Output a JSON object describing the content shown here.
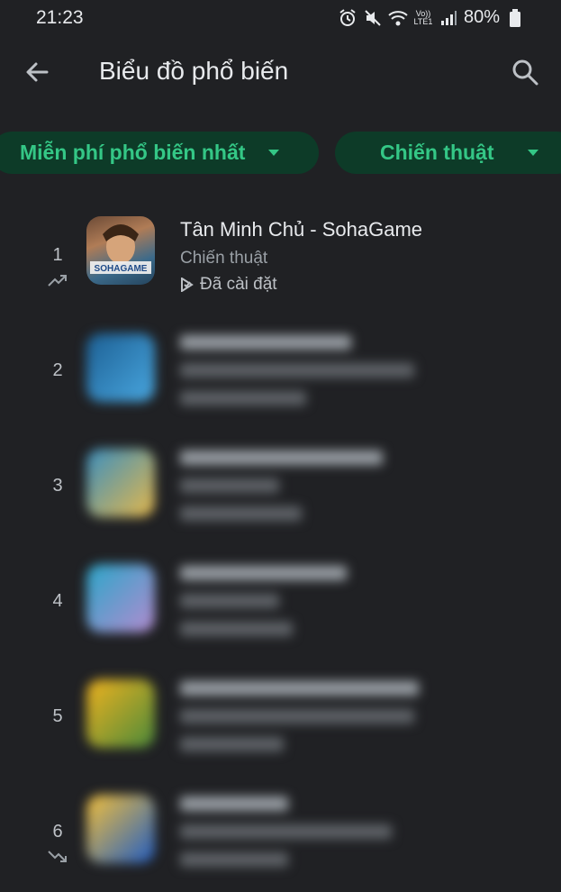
{
  "status": {
    "time": "21:23",
    "battery": "80%",
    "icons": [
      "alarm-icon",
      "mute-icon",
      "wifi-icon",
      "volte-icon",
      "signal-icon",
      "battery-icon"
    ],
    "volte_text": "Vo))\nLTE1"
  },
  "appbar": {
    "title": "Biểu đồ phổ biến"
  },
  "filters": {
    "primary_label": "Miễn phí phổ biến nhất",
    "secondary_label": "Chiến thuật"
  },
  "colors": {
    "accent": "#34c786",
    "chip_bg": "#0d3b28",
    "background": "#202124"
  },
  "apps": [
    {
      "rank": "1",
      "name": "Tân Minh Chủ - SohaGame",
      "category": "Chiến thuật",
      "status": "Đã cài đặt",
      "trend": "up",
      "icon_text": "SOHAGAME"
    },
    {
      "rank": "2",
      "blurred": true
    },
    {
      "rank": "3",
      "blurred": true
    },
    {
      "rank": "4",
      "blurred": true
    },
    {
      "rank": "5",
      "blurred": true
    },
    {
      "rank": "6",
      "blurred": true,
      "trend": "down"
    }
  ]
}
